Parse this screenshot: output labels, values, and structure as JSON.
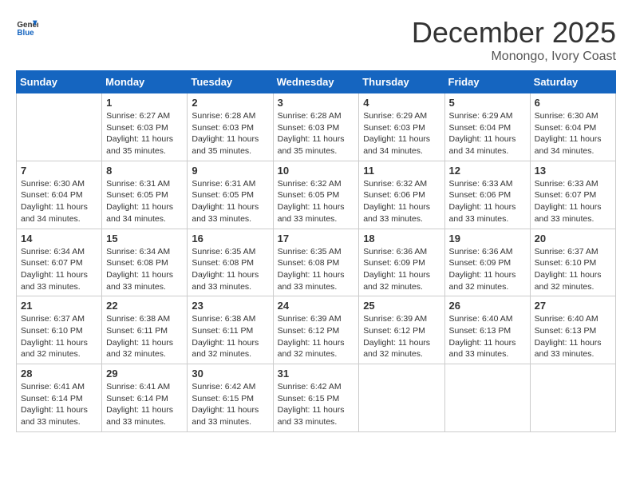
{
  "header": {
    "logo_general": "General",
    "logo_blue": "Blue",
    "month": "December 2025",
    "location": "Monongo, Ivory Coast"
  },
  "days_of_week": [
    "Sunday",
    "Monday",
    "Tuesday",
    "Wednesday",
    "Thursday",
    "Friday",
    "Saturday"
  ],
  "weeks": [
    [
      {
        "day": "",
        "info": ""
      },
      {
        "day": "1",
        "info": "Sunrise: 6:27 AM\nSunset: 6:03 PM\nDaylight: 11 hours and 35 minutes."
      },
      {
        "day": "2",
        "info": "Sunrise: 6:28 AM\nSunset: 6:03 PM\nDaylight: 11 hours and 35 minutes."
      },
      {
        "day": "3",
        "info": "Sunrise: 6:28 AM\nSunset: 6:03 PM\nDaylight: 11 hours and 35 minutes."
      },
      {
        "day": "4",
        "info": "Sunrise: 6:29 AM\nSunset: 6:03 PM\nDaylight: 11 hours and 34 minutes."
      },
      {
        "day": "5",
        "info": "Sunrise: 6:29 AM\nSunset: 6:04 PM\nDaylight: 11 hours and 34 minutes."
      },
      {
        "day": "6",
        "info": "Sunrise: 6:30 AM\nSunset: 6:04 PM\nDaylight: 11 hours and 34 minutes."
      }
    ],
    [
      {
        "day": "7",
        "info": "Sunrise: 6:30 AM\nSunset: 6:04 PM\nDaylight: 11 hours and 34 minutes."
      },
      {
        "day": "8",
        "info": "Sunrise: 6:31 AM\nSunset: 6:05 PM\nDaylight: 11 hours and 34 minutes."
      },
      {
        "day": "9",
        "info": "Sunrise: 6:31 AM\nSunset: 6:05 PM\nDaylight: 11 hours and 33 minutes."
      },
      {
        "day": "10",
        "info": "Sunrise: 6:32 AM\nSunset: 6:05 PM\nDaylight: 11 hours and 33 minutes."
      },
      {
        "day": "11",
        "info": "Sunrise: 6:32 AM\nSunset: 6:06 PM\nDaylight: 11 hours and 33 minutes."
      },
      {
        "day": "12",
        "info": "Sunrise: 6:33 AM\nSunset: 6:06 PM\nDaylight: 11 hours and 33 minutes."
      },
      {
        "day": "13",
        "info": "Sunrise: 6:33 AM\nSunset: 6:07 PM\nDaylight: 11 hours and 33 minutes."
      }
    ],
    [
      {
        "day": "14",
        "info": "Sunrise: 6:34 AM\nSunset: 6:07 PM\nDaylight: 11 hours and 33 minutes."
      },
      {
        "day": "15",
        "info": "Sunrise: 6:34 AM\nSunset: 6:08 PM\nDaylight: 11 hours and 33 minutes."
      },
      {
        "day": "16",
        "info": "Sunrise: 6:35 AM\nSunset: 6:08 PM\nDaylight: 11 hours and 33 minutes."
      },
      {
        "day": "17",
        "info": "Sunrise: 6:35 AM\nSunset: 6:08 PM\nDaylight: 11 hours and 33 minutes."
      },
      {
        "day": "18",
        "info": "Sunrise: 6:36 AM\nSunset: 6:09 PM\nDaylight: 11 hours and 32 minutes."
      },
      {
        "day": "19",
        "info": "Sunrise: 6:36 AM\nSunset: 6:09 PM\nDaylight: 11 hours and 32 minutes."
      },
      {
        "day": "20",
        "info": "Sunrise: 6:37 AM\nSunset: 6:10 PM\nDaylight: 11 hours and 32 minutes."
      }
    ],
    [
      {
        "day": "21",
        "info": "Sunrise: 6:37 AM\nSunset: 6:10 PM\nDaylight: 11 hours and 32 minutes."
      },
      {
        "day": "22",
        "info": "Sunrise: 6:38 AM\nSunset: 6:11 PM\nDaylight: 11 hours and 32 minutes."
      },
      {
        "day": "23",
        "info": "Sunrise: 6:38 AM\nSunset: 6:11 PM\nDaylight: 11 hours and 32 minutes."
      },
      {
        "day": "24",
        "info": "Sunrise: 6:39 AM\nSunset: 6:12 PM\nDaylight: 11 hours and 32 minutes."
      },
      {
        "day": "25",
        "info": "Sunrise: 6:39 AM\nSunset: 6:12 PM\nDaylight: 11 hours and 32 minutes."
      },
      {
        "day": "26",
        "info": "Sunrise: 6:40 AM\nSunset: 6:13 PM\nDaylight: 11 hours and 33 minutes."
      },
      {
        "day": "27",
        "info": "Sunrise: 6:40 AM\nSunset: 6:13 PM\nDaylight: 11 hours and 33 minutes."
      }
    ],
    [
      {
        "day": "28",
        "info": "Sunrise: 6:41 AM\nSunset: 6:14 PM\nDaylight: 11 hours and 33 minutes."
      },
      {
        "day": "29",
        "info": "Sunrise: 6:41 AM\nSunset: 6:14 PM\nDaylight: 11 hours and 33 minutes."
      },
      {
        "day": "30",
        "info": "Sunrise: 6:42 AM\nSunset: 6:15 PM\nDaylight: 11 hours and 33 minutes."
      },
      {
        "day": "31",
        "info": "Sunrise: 6:42 AM\nSunset: 6:15 PM\nDaylight: 11 hours and 33 minutes."
      },
      {
        "day": "",
        "info": ""
      },
      {
        "day": "",
        "info": ""
      },
      {
        "day": "",
        "info": ""
      }
    ]
  ]
}
